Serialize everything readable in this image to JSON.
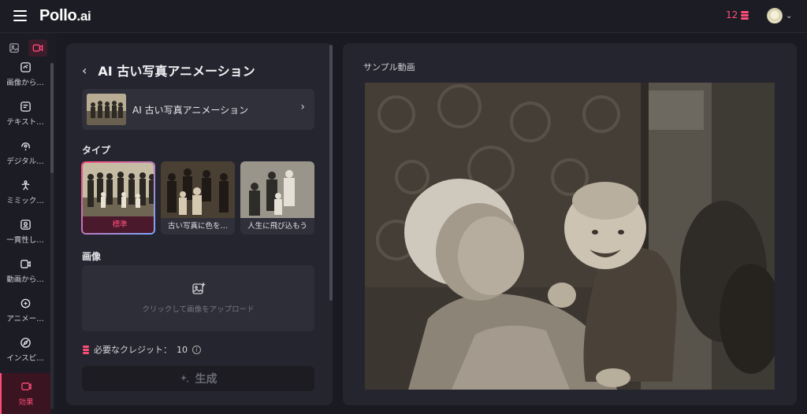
{
  "app": {
    "logo_main": "Pollo",
    "logo_suffix": ".ai"
  },
  "header": {
    "credits_count": "12",
    "accent_color": "#ff4d7a"
  },
  "sidebar": {
    "tabs": [
      {
        "icon": "image-icon"
      },
      {
        "icon": "video-icon"
      }
    ],
    "items": [
      {
        "label": "画像から…",
        "icon": "image-to-video-icon"
      },
      {
        "label": "テキスト…",
        "icon": "text-to-video-icon"
      },
      {
        "label": "デジタル…",
        "icon": "digital-human-icon"
      },
      {
        "label": "ミミック…",
        "icon": "mimic-icon"
      },
      {
        "label": "一貫性し…",
        "icon": "consistency-icon"
      },
      {
        "label": "動画から…",
        "icon": "video-to-video-icon"
      },
      {
        "label": "アニメー…",
        "icon": "animation-icon"
      },
      {
        "label": "インスピ…",
        "icon": "compass-icon"
      },
      {
        "label": "効果",
        "icon": "effects-icon"
      }
    ]
  },
  "panel": {
    "title": "AI 古い写真アニメーション",
    "effect_card_label": "AI 古い写真アニメーション",
    "type_label": "タイプ",
    "types": [
      {
        "label": "標準",
        "selected": true
      },
      {
        "label": "古い写真に色を…",
        "selected": false
      },
      {
        "label": "人生に飛び込もう",
        "selected": false
      }
    ],
    "image_label": "画像",
    "upload_text": "クリックして画像をアップロード",
    "cost_label": "必要なクレジット：",
    "cost_value": "10",
    "generate_label": "生成"
  },
  "preview": {
    "label": "サンプル動画"
  }
}
